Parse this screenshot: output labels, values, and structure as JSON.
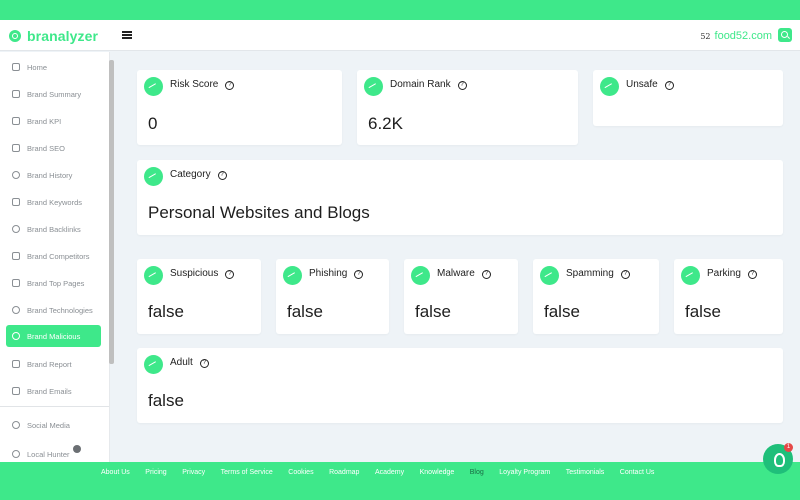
{
  "header": {
    "logo_text": "branalyzer",
    "domain_badge": "52",
    "domain": "food52.com"
  },
  "sidebar": {
    "items": [
      {
        "label": "Home"
      },
      {
        "label": "Brand Summary"
      },
      {
        "label": "Brand KPI"
      },
      {
        "label": "Brand SEO"
      },
      {
        "label": "Brand History"
      },
      {
        "label": "Brand Keywords"
      },
      {
        "label": "Brand Backlinks"
      },
      {
        "label": "Brand Competitors"
      },
      {
        "label": "Brand Top Pages"
      },
      {
        "label": "Brand Technologies"
      },
      {
        "label": "Brand Malicious"
      },
      {
        "label": "Brand Report"
      },
      {
        "label": "Brand Emails"
      },
      {
        "label": "Social Media"
      },
      {
        "label": "Local Hunter"
      }
    ],
    "active_item": "Brand Malicious"
  },
  "cards": {
    "risk_score": {
      "title": "Risk Score",
      "value": "0"
    },
    "domain_rank": {
      "title": "Domain Rank",
      "value": "6.2K"
    },
    "unsafe": {
      "title": "Unsafe",
      "value": ""
    },
    "category": {
      "title": "Category",
      "value": "Personal Websites and Blogs"
    },
    "suspicious": {
      "title": "Suspicious",
      "value": "false"
    },
    "phishing": {
      "title": "Phishing",
      "value": "false"
    },
    "malware": {
      "title": "Malware",
      "value": "false"
    },
    "spamming": {
      "title": "Spamming",
      "value": "false"
    },
    "parking": {
      "title": "Parking",
      "value": "false"
    },
    "adult": {
      "title": "Adult",
      "value": "false"
    }
  },
  "help_glyph": "?",
  "footer": {
    "links": [
      "About Us",
      "Pricing",
      "Privacy",
      "Terms of Service",
      "Cookies",
      "Roadmap",
      "Academy",
      "Knowledge",
      "Blog",
      "Loyalty Program",
      "Testimonials",
      "Contact Us"
    ],
    "current": "Blog"
  },
  "chat": {
    "badge_count": "1"
  },
  "colors": {
    "accent": "#3ee88a",
    "active_footer_link": "#1a6b44",
    "badge": "#e54848"
  }
}
